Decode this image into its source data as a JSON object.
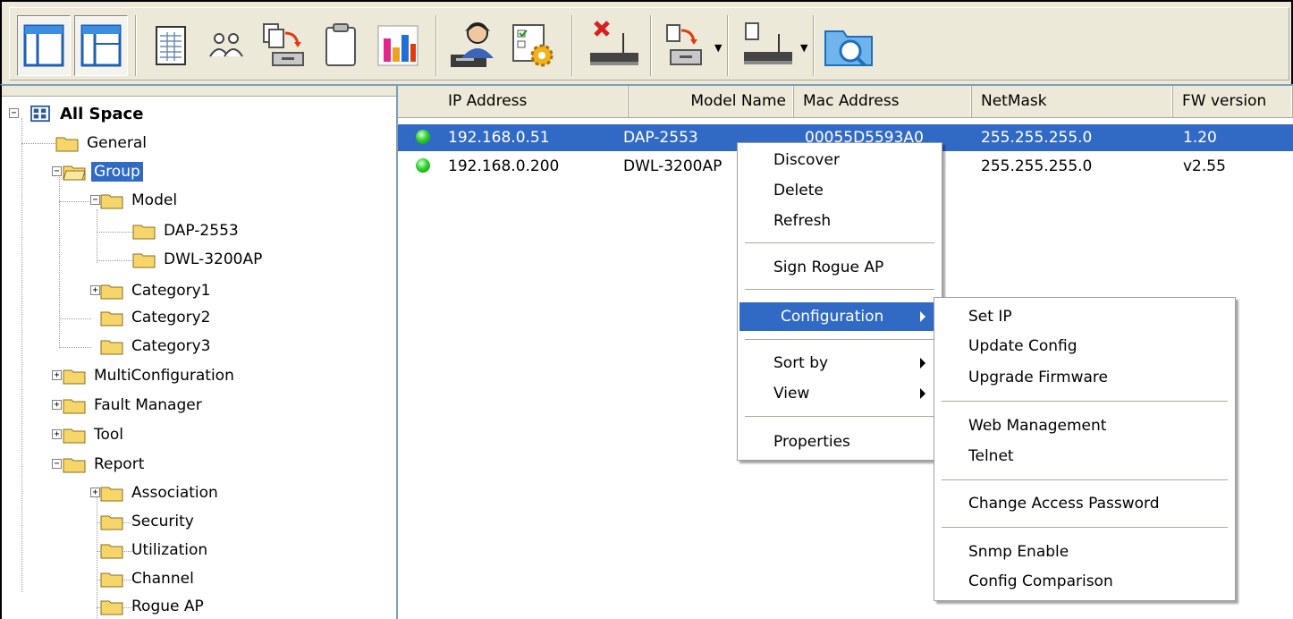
{
  "toolbar": {
    "buttons": [
      {
        "name": "view-layout-1-icon"
      },
      {
        "name": "view-layout-2-icon"
      },
      {
        "name": "spreadsheet-icon"
      },
      {
        "name": "users-icon"
      },
      {
        "name": "copy-to-device-icon"
      },
      {
        "name": "clipboard-icon"
      },
      {
        "name": "bar-chart-icon"
      },
      {
        "name": "user-computer-icon"
      },
      {
        "name": "settings-gear-icon"
      },
      {
        "name": "delete-ap-icon"
      },
      {
        "name": "send-to-device-icon"
      },
      {
        "name": "access-point-icon"
      },
      {
        "name": "search-folder-icon"
      }
    ]
  },
  "tree": {
    "root": "All Space",
    "general": "General",
    "group": "Group",
    "model": "Model",
    "dap2553": "DAP-2553",
    "dwl3200": "DWL-3200AP",
    "cat1": "Category1",
    "cat2": "Category2",
    "cat3": "Category3",
    "multiconfig": "MultiConfiguration",
    "fault": "Fault Manager",
    "tool": "Tool",
    "report": "Report",
    "association": "Association",
    "security": "Security",
    "utilization": "Utilization",
    "channel": "Channel",
    "rogue": "Rogue AP"
  },
  "list": {
    "columns": [
      "IP Address",
      "Model Name",
      "Mac Address",
      "NetMask",
      "FW version"
    ],
    "rows": [
      {
        "ip": "192.168.0.51",
        "model": "DAP-2553",
        "mac": "00055D5593A0",
        "netmask": "255.255.255.0",
        "fw": "1.20",
        "status_color": "#2fd12f"
      },
      {
        "ip": "192.168.0.200",
        "model": "DWL-3200AP",
        "mac": "",
        "netmask": "255.255.255.0",
        "fw": "v2.55",
        "status_color": "#2fd12f"
      }
    ]
  },
  "context_menu": {
    "items": [
      "Discover",
      "Delete",
      "Refresh",
      "Sign Rogue AP",
      "Configuration",
      "Sort by",
      "View",
      "Properties"
    ]
  },
  "submenu": {
    "items": [
      "Set IP",
      "Update Config",
      "Upgrade Firmware",
      "Web Management",
      "Telnet",
      "Change Access Password",
      "Snmp Enable",
      "Config Comparison"
    ]
  },
  "colors": {
    "selection": "#316ac5",
    "chrome": "#ece9d8"
  }
}
